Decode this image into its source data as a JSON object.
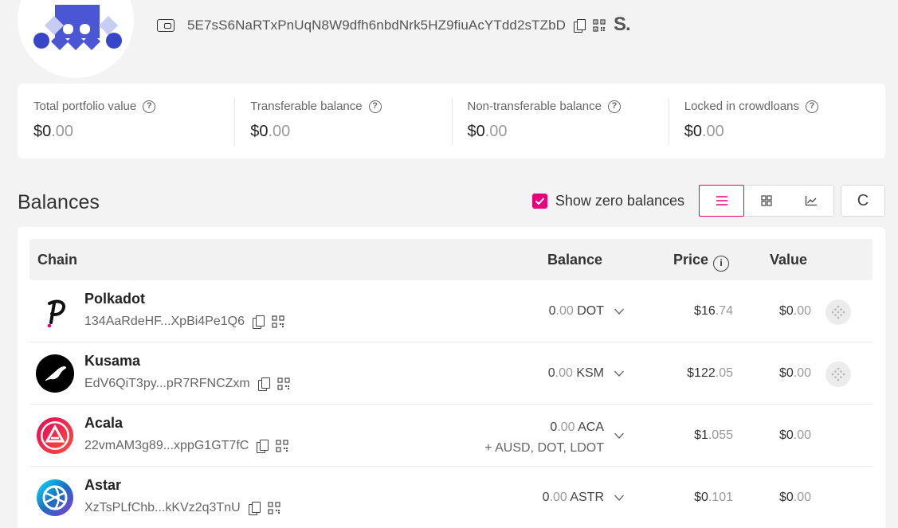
{
  "header": {
    "address": "5E7sS6NaRTxPnUqN8W9dfh6nbdNrk5HZ9fiuAcYTdd2sTZbD",
    "subscan_label": "S."
  },
  "summary": [
    {
      "label": "Total portfolio value",
      "value_int": "$0",
      "value_dec": ".00"
    },
    {
      "label": "Transferable balance",
      "value_int": "$0",
      "value_dec": ".00"
    },
    {
      "label": "Non-transferable balance",
      "value_int": "$0",
      "value_dec": ".00"
    },
    {
      "label": "Locked in crowdloans",
      "value_int": "$0",
      "value_dec": ".00"
    }
  ],
  "balances": {
    "title": "Balances",
    "show_zero_label": "Show zero balances",
    "show_zero_checked": true,
    "refresh_glyph": "C",
    "columns": {
      "chain": "Chain",
      "balance": "Balance",
      "price": "Price",
      "value": "Value"
    },
    "rows": [
      {
        "name": "Polkadot",
        "address": "134AaRdeHF...XpBi4Pe1Q6",
        "bal_int": "0",
        "bal_dec": ".00",
        "token": "DOT",
        "extra": "",
        "price_int": "$16",
        "price_dec": ".74",
        "value_int": "$0",
        "value_dec": ".00",
        "stakable": true
      },
      {
        "name": "Kusama",
        "address": "EdV6QiT3py...pR7RFNCZxm",
        "bal_int": "0",
        "bal_dec": ".00",
        "token": "KSM",
        "extra": "",
        "price_int": "$122",
        "price_dec": ".05",
        "value_int": "$0",
        "value_dec": ".00",
        "stakable": true
      },
      {
        "name": "Acala",
        "address": "22vmAM3g89...xppG1GT7fC",
        "bal_int": "0",
        "bal_dec": ".00",
        "token": "ACA",
        "extra": "+ AUSD, DOT, LDOT",
        "price_int": "$1",
        "price_dec": ".055",
        "value_int": "$0",
        "value_dec": ".00",
        "stakable": false
      },
      {
        "name": "Astar",
        "address": "XzTsPLfChb...kKVz2q3TnU",
        "bal_int": "0",
        "bal_dec": ".00",
        "token": "ASTR",
        "extra": "",
        "price_int": "$0",
        "price_dec": ".101",
        "value_int": "$0",
        "value_dec": ".00",
        "stakable": false
      }
    ]
  },
  "colors": {
    "accent": "#e6007a",
    "polkadot_dot": "#e6007a",
    "identicon_blue": "#3f50d6",
    "identicon_light": "#c9cff2"
  }
}
